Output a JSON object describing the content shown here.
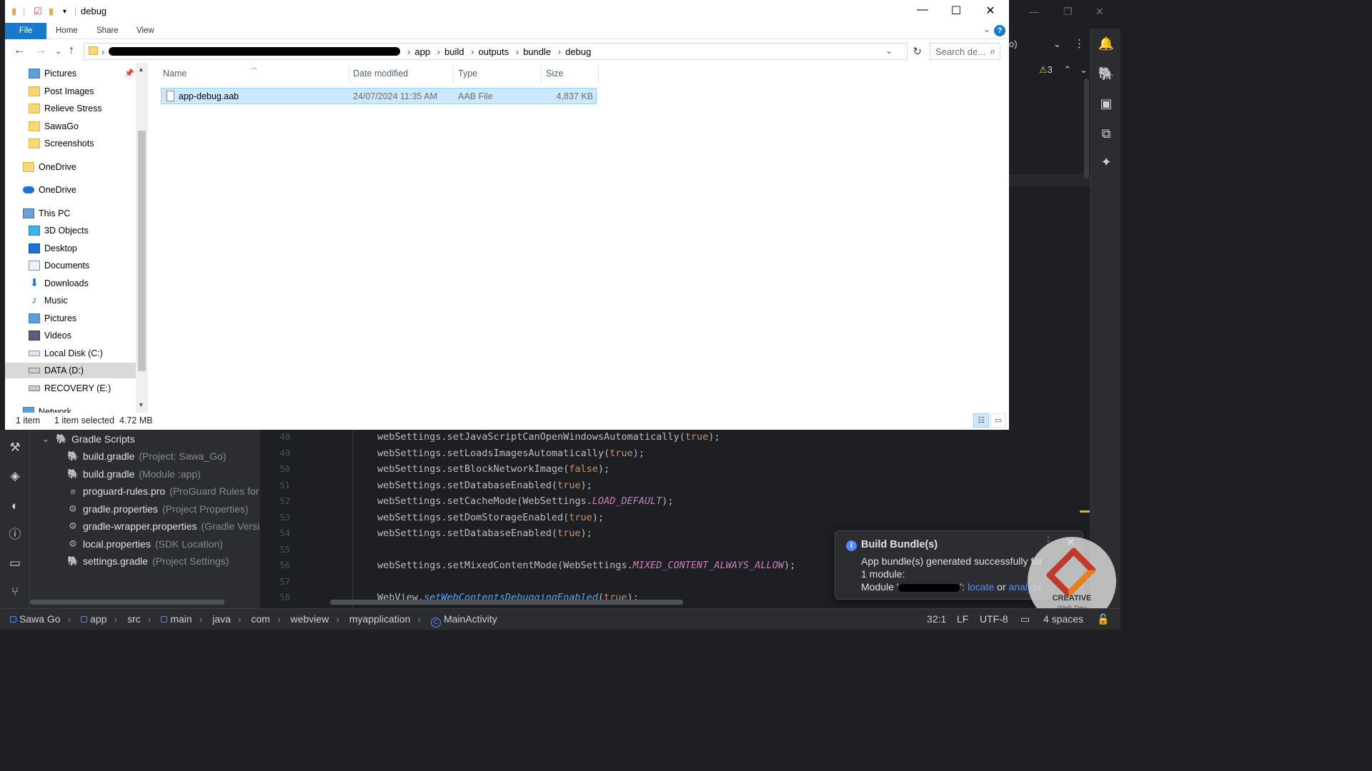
{
  "explorer": {
    "title": "debug",
    "ribbon_tabs": [
      "File",
      "Home",
      "Share",
      "View"
    ],
    "breadcrumb": [
      "app",
      "build",
      "outputs",
      "bundle",
      "debug"
    ],
    "search_placeholder": "Search de...",
    "nav_items": [
      {
        "label": "Pictures",
        "icon": "pictures-icon",
        "pinned": true
      },
      {
        "label": "Post Images",
        "icon": "folder-icon"
      },
      {
        "label": "Relieve Stress",
        "icon": "folder-icon"
      },
      {
        "label": "SawaGo",
        "icon": "folder-icon"
      },
      {
        "label": "Screenshots",
        "icon": "folder-icon"
      },
      {
        "label": "OneDrive",
        "icon": "folder-icon"
      },
      {
        "label": "OneDrive",
        "icon": "cloud-icon"
      },
      {
        "label": "This PC",
        "icon": "computer-icon"
      },
      {
        "label": "3D Objects",
        "icon": "cube-icon"
      },
      {
        "label": "Desktop",
        "icon": "desktop-icon"
      },
      {
        "label": "Documents",
        "icon": "documents-icon"
      },
      {
        "label": "Downloads",
        "icon": "download-icon"
      },
      {
        "label": "Music",
        "icon": "music-icon"
      },
      {
        "label": "Pictures",
        "icon": "pictures-icon"
      },
      {
        "label": "Videos",
        "icon": "videos-icon"
      },
      {
        "label": "Local Disk (C:)",
        "icon": "drive-icon"
      },
      {
        "label": "DATA (D:)",
        "icon": "drive-icon",
        "selected": true
      },
      {
        "label": "RECOVERY (E:)",
        "icon": "drive-icon"
      },
      {
        "label": "Network",
        "icon": "network-icon"
      }
    ],
    "columns": {
      "name": "Name",
      "date": "Date modified",
      "type": "Type",
      "size": "Size"
    },
    "files": [
      {
        "name": "app-debug.aab",
        "date": "24/07/2024 11:35 AM",
        "type": "AAB File",
        "size": "4,837 KB"
      }
    ],
    "status": {
      "count": "1 item",
      "selection": "1 item selected  4.72 MB"
    }
  },
  "ide": {
    "warning_count": "3",
    "project_tree": [
      {
        "label": "Gradle Scripts",
        "hint": ""
      },
      {
        "label": "build.gradle",
        "hint": "(Project: Sawa_Go)"
      },
      {
        "label": "build.gradle",
        "hint": "(Module :app)"
      },
      {
        "label": "proguard-rules.pro",
        "hint": "(ProGuard Rules for"
      },
      {
        "label": "gradle.properties",
        "hint": "(Project Properties)"
      },
      {
        "label": "gradle-wrapper.properties",
        "hint": "(Gradle Versi"
      },
      {
        "label": "local.properties",
        "hint": "(SDK Location)"
      },
      {
        "label": "settings.gradle",
        "hint": "(Project Settings)"
      }
    ],
    "line_numbers": [
      "48",
      "49",
      "50",
      "51",
      "52",
      "53",
      "54",
      "55",
      "56",
      "57",
      "58"
    ],
    "code_lines": [
      {
        "pre": "webSettings.setJavaScriptCanOpenWindowsAutomatically(",
        "kw": "true",
        "post": ");"
      },
      {
        "pre": "webSettings.setLoadsImagesAutomatically(",
        "kw": "true",
        "post": ");"
      },
      {
        "pre": "webSettings.setBlockNetworkImage(",
        "kw": "false",
        "post": ");"
      },
      {
        "pre": "webSettings.setDatabaseEnabled(",
        "kw": "true",
        "post": ");"
      },
      {
        "pre": "webSettings.setCacheMode(WebSettings.",
        "st": "LOAD_DEFAULT",
        "post": ");"
      },
      {
        "pre": "webSettings.setDomStorageEnabled(",
        "kw": "true",
        "post": ");"
      },
      {
        "pre": "webSettings.setDatabaseEnabled(",
        "kw": "true",
        "post": ");"
      },
      {
        "pre": "",
        "post": ""
      },
      {
        "pre": "webSettings.setMixedContentMode(WebSettings.",
        "st": "MIXED_CONTENT_ALWAYS_ALLOW",
        "post": ");"
      },
      {
        "pre": "",
        "post": ""
      },
      {
        "pre": "WebView.",
        "it": "setWebContentsDebuggingEnabled",
        "mid": "(",
        "kw": "true",
        "post": ");"
      }
    ],
    "breadcrumb": [
      "Sawa Go",
      "app",
      "src",
      "main",
      "java",
      "com",
      "webview",
      "myapplication",
      "MainActivity"
    ],
    "status_right": {
      "position": "32:1",
      "line_sep": "LF",
      "encoding": "UTF-8",
      "indent": "4 spaces"
    },
    "notification": {
      "title": "Build Bundle(s)",
      "line1": "App bundle(s) generated successfully for",
      "line2": "1 module:",
      "module_prefix": "Module '",
      "module_suffix": "': ",
      "locate": "locate",
      "or": " or ",
      "analyze": "analyze..."
    },
    "watermark": {
      "brand": "CREATIVE",
      "sub": "Web Dev"
    }
  }
}
